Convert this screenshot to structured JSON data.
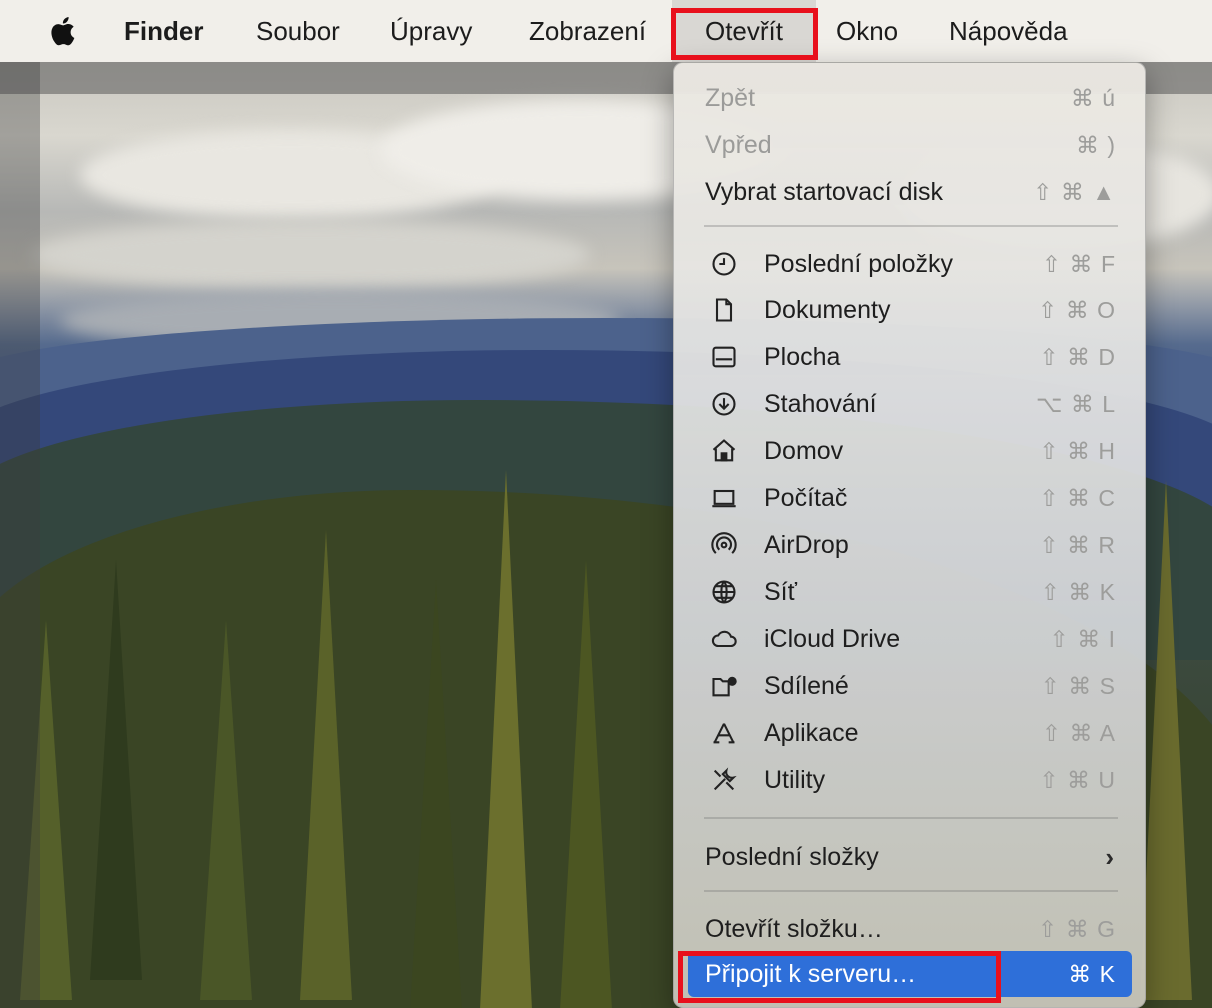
{
  "menubar": {
    "apple": "apple-logo",
    "items": [
      "Finder",
      "Soubor",
      "Úpravy",
      "Zobrazení",
      "Otevřít",
      "Okno",
      "Nápověda"
    ],
    "active": "Otevřít"
  },
  "dropdown": {
    "nav": [
      {
        "label": "Zpět",
        "shortcut": "⌘ ú",
        "enabled": false
      },
      {
        "label": "Vpřed",
        "shortcut": "⌘ )",
        "enabled": false
      },
      {
        "label": "Vybrat startovací disk",
        "shortcut": "⇧ ⌘ ▲",
        "enabled": true
      }
    ],
    "places": [
      {
        "label": "Poslední položky",
        "shortcut": "⇧ ⌘ F",
        "icon": "clock-icon"
      },
      {
        "label": "Dokumenty",
        "shortcut": "⇧ ⌘ O",
        "icon": "document-icon"
      },
      {
        "label": "Plocha",
        "shortcut": "⇧ ⌘ D",
        "icon": "desktop-icon"
      },
      {
        "label": "Stahování",
        "shortcut": "⌥ ⌘ L",
        "icon": "download-icon"
      },
      {
        "label": "Domov",
        "shortcut": "⇧ ⌘ H",
        "icon": "home-icon"
      },
      {
        "label": "Počítač",
        "shortcut": "⇧ ⌘ C",
        "icon": "laptop-icon"
      },
      {
        "label": "AirDrop",
        "shortcut": "⇧ ⌘ R",
        "icon": "airdrop-icon"
      },
      {
        "label": "Síť",
        "shortcut": "⇧ ⌘ K",
        "icon": "network-globe-icon"
      },
      {
        "label": "iCloud Drive",
        "shortcut": "⇧ ⌘ I",
        "icon": "cloud-icon"
      },
      {
        "label": "Sdílené",
        "shortcut": "⇧ ⌘ S",
        "icon": "shared-folder-icon"
      },
      {
        "label": "Aplikace",
        "shortcut": "⇧ ⌘ A",
        "icon": "applications-icon"
      },
      {
        "label": "Utility",
        "shortcut": "⇧ ⌘ U",
        "icon": "utilities-tools-icon"
      }
    ],
    "recent_folders": {
      "label": "Poslední složky",
      "submenu_indicator": "›"
    },
    "go_to_folder": {
      "label": "Otevřít složku…",
      "shortcut": "⇧ ⌘ G"
    },
    "connect_server": {
      "label": "Připojit k serveru…",
      "shortcut": "⌘ K",
      "highlighted": true
    }
  },
  "colors": {
    "menubar_bg": "#f1efea",
    "highlight": "#2e6fd9",
    "annotation_red": "#e8101c",
    "disabled_text": "#9b9b99"
  }
}
